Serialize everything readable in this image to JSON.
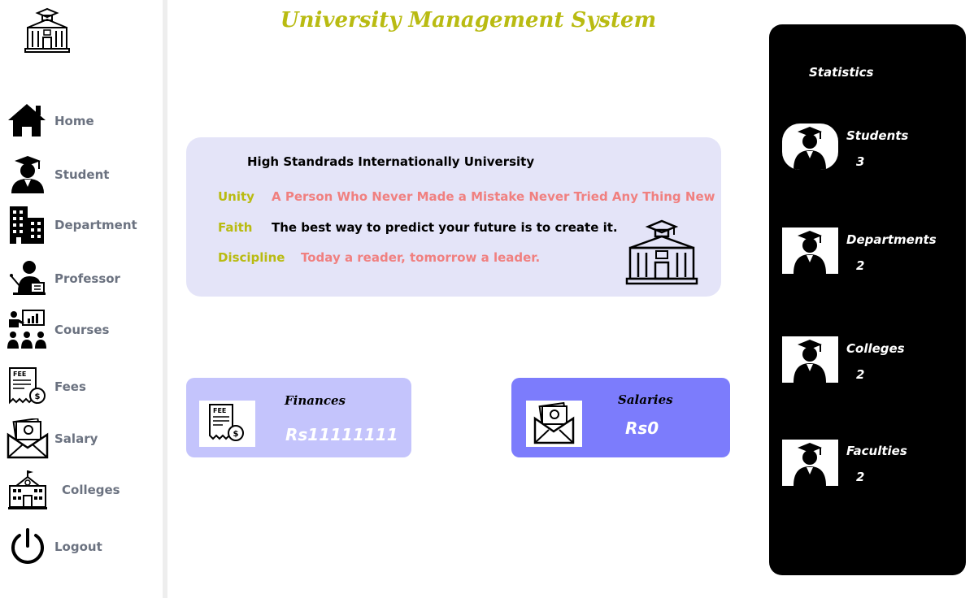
{
  "app": {
    "title": "University Management System"
  },
  "sidebar": {
    "logo_icon": "university-building-icon",
    "items": [
      {
        "label": "Home",
        "icon": "home-icon"
      },
      {
        "label": "Student",
        "icon": "student-graduate-icon"
      },
      {
        "label": "Department",
        "icon": "office-building-icon"
      },
      {
        "label": "Professor",
        "icon": "professor-teaching-icon"
      },
      {
        "label": "Courses",
        "icon": "classroom-presentation-icon"
      },
      {
        "label": "Fees",
        "icon": "fee-receipt-icon"
      },
      {
        "label": "Salary",
        "icon": "money-envelope-icon"
      },
      {
        "label": "Colleges",
        "icon": "college-building-icon"
      },
      {
        "label": "Logout",
        "icon": "power-icon"
      }
    ]
  },
  "info_card": {
    "university_name": "High Standrads Internationally University",
    "mottos": [
      {
        "key": "Unity",
        "text": "A Person Who Never Made a Mistake Never Tried Any Thing New",
        "color": "#f08080"
      },
      {
        "key": "Faith",
        "text": "The best way to predict your future is to create it.",
        "color": "#000000"
      },
      {
        "key": "Discipline",
        "text": "Today a reader, tomorrow a leader.",
        "color": "#f08080"
      }
    ],
    "icon": "university-building-icon"
  },
  "finances": {
    "title": "Finances",
    "value": "Rs11111111",
    "icon": "fee-receipt-icon"
  },
  "salaries": {
    "title": "Salaries",
    "value": "Rs0",
    "icon": "money-envelope-icon"
  },
  "statistics": {
    "heading": "Statistics",
    "items": [
      {
        "label": "Students",
        "value": "3",
        "icon": "graduate-avatar-icon"
      },
      {
        "label": "Departments",
        "value": "2",
        "icon": "graduate-avatar-icon"
      },
      {
        "label": "Colleges",
        "value": "2",
        "icon": "graduate-avatar-icon"
      },
      {
        "label": "Faculties",
        "value": "2",
        "icon": "graduate-avatar-icon"
      }
    ]
  },
  "colors": {
    "title": "#b9bb12",
    "motto_key": "#b9bb12",
    "info_card_bg": "#e4e4f8",
    "finances_bg": "#c4c4fc",
    "salaries_bg": "#7c7cfc",
    "stats_bg": "#000000",
    "nav_label": "#6b7280"
  }
}
